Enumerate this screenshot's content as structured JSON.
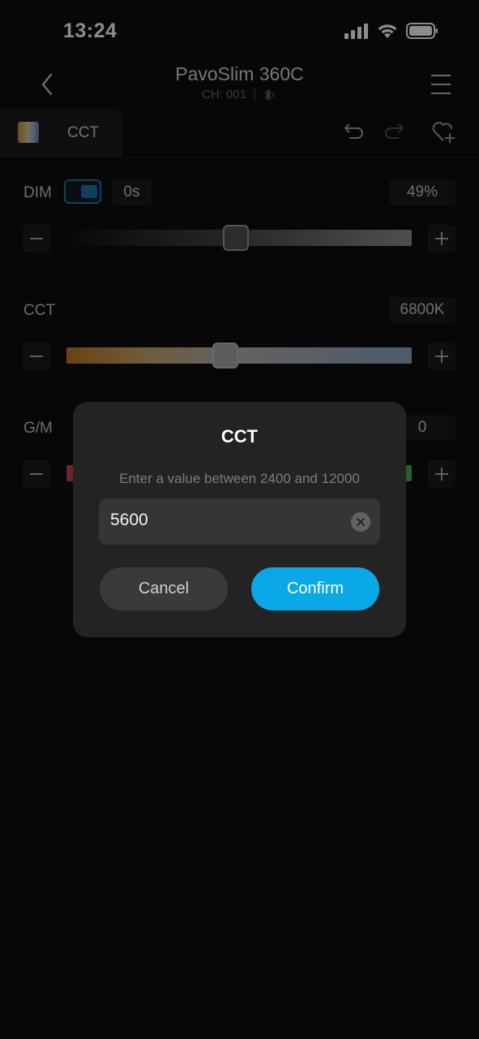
{
  "status_bar": {
    "time": "13:24"
  },
  "nav": {
    "title": "PavoSlim 360C",
    "channel": "CH: 001",
    "back_icon": "chevron-left-icon",
    "menu_icon": "hamburger-menu-icon"
  },
  "tab": {
    "label": "CCT"
  },
  "controls": {
    "dim": {
      "label": "DIM",
      "fade": "0s",
      "value": "49%",
      "level": 0.49,
      "toggle_on": true
    },
    "cct": {
      "label": "CCT",
      "value": "6800K"
    },
    "gm": {
      "label": "G/M",
      "value": "0"
    }
  },
  "dialog": {
    "title": "CCT",
    "hint": "Enter a value between 2400 and 12000",
    "input_value": "5600",
    "cancel_label": "Cancel",
    "confirm_label": "Confirm"
  },
  "colors": {
    "accent": "#0aa8e6",
    "toggle": "#127ab0",
    "background": "#0d0d0d"
  }
}
